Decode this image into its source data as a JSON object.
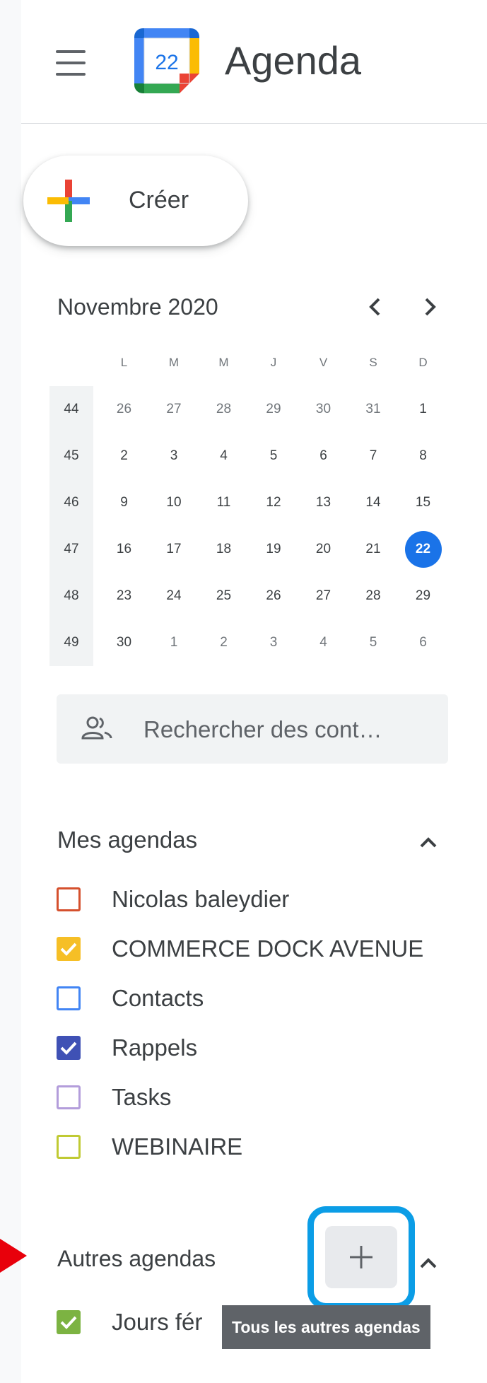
{
  "header": {
    "app_title": "Agenda",
    "logo_day": "22",
    "menu_icon": "hamburger-menu-icon"
  },
  "create_button": {
    "label": "Créer",
    "icon": "multicolor-plus-icon"
  },
  "mini_calendar": {
    "month_label": "Novembre 2020",
    "day_headers": [
      "L",
      "M",
      "M",
      "J",
      "V",
      "S",
      "D"
    ],
    "rows": [
      {
        "week": "44",
        "days": [
          "26",
          "27",
          "28",
          "29",
          "30",
          "31",
          "1"
        ]
      },
      {
        "week": "45",
        "days": [
          "2",
          "3",
          "4",
          "5",
          "6",
          "7",
          "8"
        ]
      },
      {
        "week": "46",
        "days": [
          "9",
          "10",
          "11",
          "12",
          "13",
          "14",
          "15"
        ]
      },
      {
        "week": "47",
        "days": [
          "16",
          "17",
          "18",
          "19",
          "20",
          "21",
          "22"
        ]
      },
      {
        "week": "48",
        "days": [
          "23",
          "24",
          "25",
          "26",
          "27",
          "28",
          "29"
        ]
      },
      {
        "week": "49",
        "days": [
          "30",
          "1",
          "2",
          "3",
          "4",
          "5",
          "6"
        ]
      }
    ],
    "today": "22",
    "today_color": "#1a73e8"
  },
  "contact_search": {
    "placeholder": "Rechercher des cont…",
    "icon": "people-icon"
  },
  "my_calendars": {
    "title": "Mes agendas",
    "items": [
      {
        "label": "Nicolas baleydier",
        "color": "#d5502d",
        "checked": false
      },
      {
        "label": "COMMERCE DOCK AVENUE",
        "color": "#f6bf26",
        "checked": true
      },
      {
        "label": "Contacts",
        "color": "#4285f4",
        "checked": false
      },
      {
        "label": "Rappels",
        "color": "#3f51b5",
        "checked": true
      },
      {
        "label": "Tasks",
        "color": "#b39ddb",
        "checked": false
      },
      {
        "label": "WEBINAIRE",
        "color": "#c0ca33",
        "checked": false
      }
    ]
  },
  "other_calendars": {
    "title": "Autres agendas",
    "add_button_icon": "plus-icon",
    "tooltip": "Tous les autres agendas",
    "items": [
      {
        "label": "Jours fér",
        "color": "#7cb342",
        "checked": true
      }
    ]
  },
  "annotations": {
    "highlight_color": "#0b9de6",
    "arrow_color": "#e8000b"
  }
}
